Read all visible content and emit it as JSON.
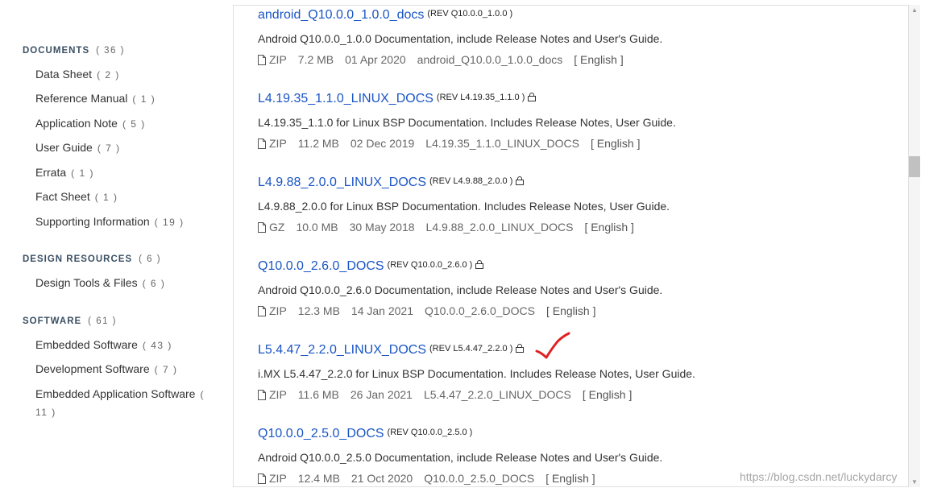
{
  "sidebar": {
    "sections": [
      {
        "title": "DOCUMENTS",
        "count": "( 36 )",
        "items": [
          {
            "label": "Data Sheet",
            "count": "( 2 )"
          },
          {
            "label": "Reference Manual",
            "count": "( 1 )"
          },
          {
            "label": "Application Note",
            "count": "( 5 )"
          },
          {
            "label": "User Guide",
            "count": "( 7 )"
          },
          {
            "label": "Errata",
            "count": "( 1 )"
          },
          {
            "label": "Fact Sheet",
            "count": "( 1 )"
          },
          {
            "label": "Supporting Information",
            "count": "( 19 )"
          }
        ]
      },
      {
        "title": "DESIGN RESOURCES",
        "count": "( 6 )",
        "items": [
          {
            "label": "Design Tools & Files",
            "count": "( 6 )"
          }
        ]
      },
      {
        "title": "SOFTWARE",
        "count": "( 61 )",
        "items": [
          {
            "label": "Embedded Software",
            "count": "( 43 )"
          },
          {
            "label": "Development Software",
            "count": "( 7 )"
          },
          {
            "label": "Embedded Application Software",
            "count": "( 11 )"
          }
        ]
      }
    ]
  },
  "docs": [
    {
      "title": "android_Q10.0.0_1.0.0_docs",
      "rev": "(REV Q10.0.0_1.0.0 )",
      "locked": false,
      "desc": "Android Q10.0.0_1.0.0 Documentation, include Release Notes and User's Guide.",
      "type": "ZIP",
      "size": "7.2 MB",
      "date": "01 Apr 2020",
      "name": "android_Q10.0.0_1.0.0_docs",
      "lang": "[ English ]"
    },
    {
      "title": "L4.19.35_1.1.0_LINUX_DOCS",
      "rev": "(REV L4.19.35_1.1.0 )",
      "locked": true,
      "desc": "L4.19.35_1.1.0 for Linux BSP Documentation. Includes Release Notes, User Guide.",
      "type": "ZIP",
      "size": "11.2 MB",
      "date": "02 Dec 2019",
      "name": "L4.19.35_1.1.0_LINUX_DOCS",
      "lang": "[ English ]"
    },
    {
      "title": "L4.9.88_2.0.0_LINUX_DOCS",
      "rev": "(REV L4.9.88_2.0.0 )",
      "locked": true,
      "desc": "L4.9.88_2.0.0 for Linux BSP Documentation. Includes Release Notes, User Guide.",
      "type": "GZ",
      "size": "10.0 MB",
      "date": "30 May 2018",
      "name": "L4.9.88_2.0.0_LINUX_DOCS",
      "lang": "[ English ]"
    },
    {
      "title": "Q10.0.0_2.6.0_DOCS",
      "rev": "(REV Q10.0.0_2.6.0 )",
      "locked": true,
      "desc": "Android Q10.0.0_2.6.0 Documentation, include Release Notes and User's Guide.",
      "type": "ZIP",
      "size": "12.3 MB",
      "date": "14 Jan 2021",
      "name": "Q10.0.0_2.6.0_DOCS",
      "lang": "[ English ]"
    },
    {
      "title": "L5.4.47_2.2.0_LINUX_DOCS",
      "rev": "(REV L5.4.47_2.2.0 )",
      "locked": true,
      "desc": "i.MX L5.4.47_2.2.0 for Linux BSP Documentation. Includes Release Notes, User Guide.",
      "type": "ZIP",
      "size": "11.6 MB",
      "date": "26 Jan 2021",
      "name": "L5.4.47_2.2.0_LINUX_DOCS",
      "lang": "[ English ]"
    },
    {
      "title": "Q10.0.0_2.5.0_DOCS",
      "rev": "(REV Q10.0.0_2.5.0 )",
      "locked": false,
      "desc": "Android Q10.0.0_2.5.0 Documentation, include Release Notes and User's Guide.",
      "type": "ZIP",
      "size": "12.4 MB",
      "date": "21 Oct 2020",
      "name": "Q10.0.0_2.5.0_DOCS",
      "lang": "[ English ]"
    }
  ],
  "watermark": "https://blog.csdn.net/luckydarcy",
  "colors": {
    "link": "#1a55c4",
    "section": "#3a4f63",
    "check": "#e02020"
  }
}
